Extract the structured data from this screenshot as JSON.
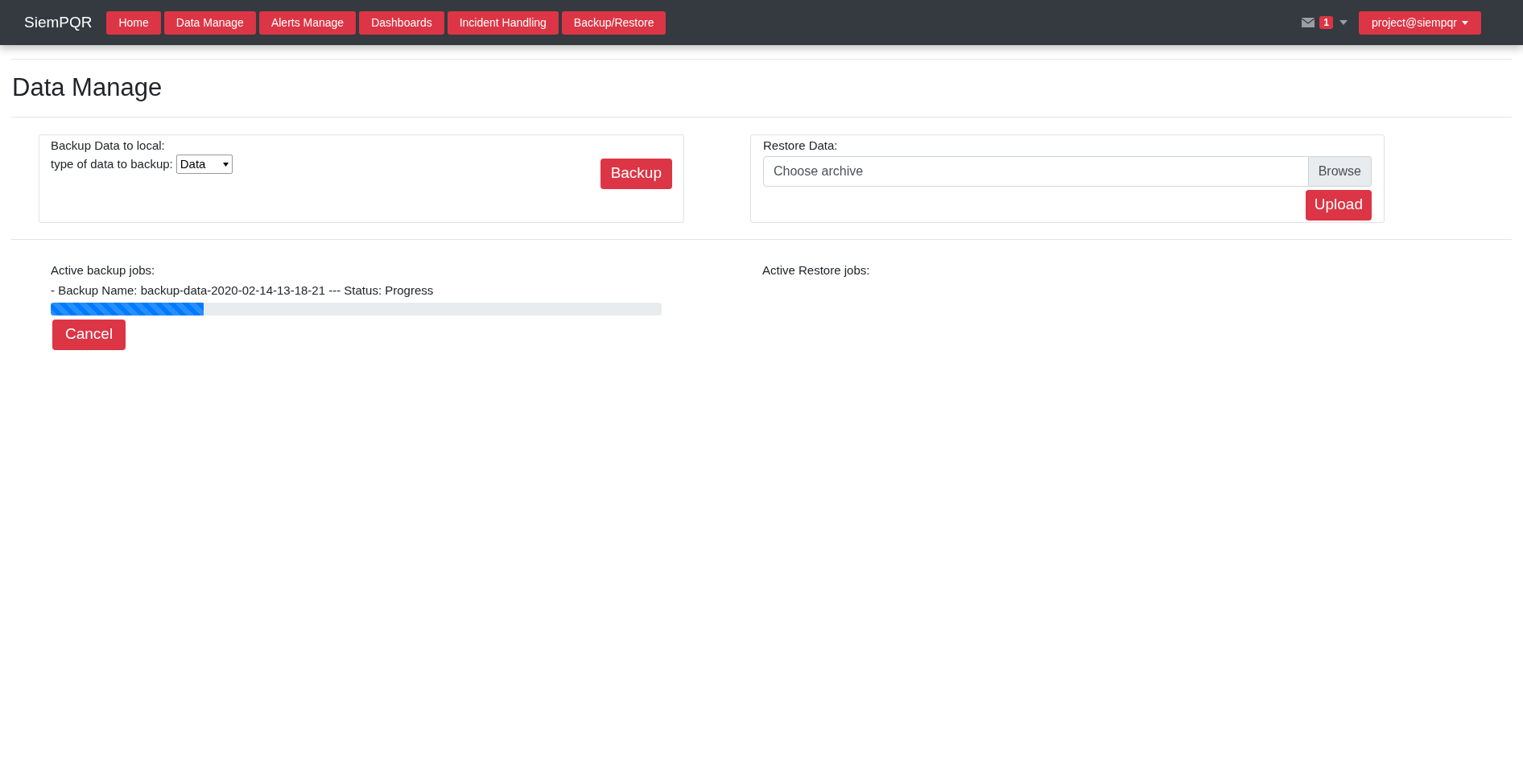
{
  "navbar": {
    "brand": "SiemPQR",
    "items": [
      {
        "label": "Home"
      },
      {
        "label": "Data Manage"
      },
      {
        "label": "Alerts Manage"
      },
      {
        "label": "Dashboards"
      },
      {
        "label": "Incident Handling"
      },
      {
        "label": "Backup/Restore"
      }
    ],
    "messages_badge": "1",
    "user_menu": "project@siempqr"
  },
  "page_title": "Data Manage",
  "backup_panel": {
    "title": "Backup Data to local:",
    "type_label": "type of data to backup:",
    "type_value": "Data",
    "button": "Backup"
  },
  "restore_panel": {
    "title": "Restore Data:",
    "file_placeholder": "Choose archive",
    "browse": "Browse",
    "button": "Upload"
  },
  "backup_jobs": {
    "title": "Active backup jobs:",
    "jobs": [
      {
        "text": "- Backup Name: backup-data-2020-02-14-13-18-21 --- Status: Progress",
        "level": 0.25,
        "button": "Cancel"
      }
    ]
  },
  "restore_jobs": {
    "title": "Active Restore jobs:"
  }
}
